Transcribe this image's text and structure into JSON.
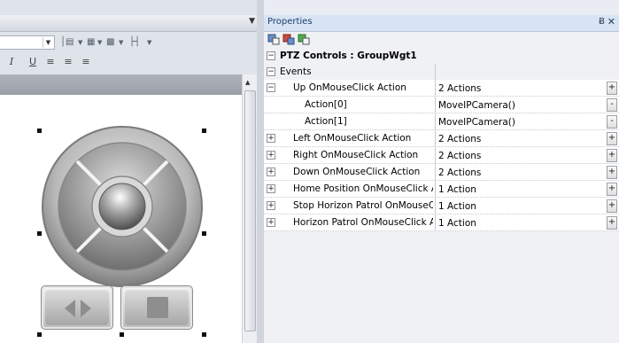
{
  "toolbar": {
    "font_combo_value": "",
    "icons": [
      "align-left-icon",
      "grid-icon",
      "distribute-icon"
    ],
    "format_buttons": [
      "I",
      "U",
      "align-left",
      "align-center",
      "align-right"
    ]
  },
  "properties": {
    "title": "Properties",
    "pin_label": "Ƀ",
    "close_label": "✕",
    "object": "PTZ Controls : GroupWgt1",
    "category": "Events",
    "rows": [
      {
        "name": "Up OnMouseClick Action",
        "value": "2 Actions",
        "expander": "−",
        "button": "+",
        "indent": 1
      },
      {
        "name": "Action[0]",
        "value": "MoveIPCamera()",
        "expander": "",
        "button": "-",
        "indent": 2
      },
      {
        "name": "Action[1]",
        "value": "MoveIPCamera()",
        "expander": "",
        "button": "-",
        "indent": 2
      },
      {
        "name": "Left OnMouseClick Action",
        "value": "2 Actions",
        "expander": "+",
        "button": "+",
        "indent": 1
      },
      {
        "name": "Right OnMouseClick Action",
        "value": "2 Actions",
        "expander": "+",
        "button": "+",
        "indent": 1
      },
      {
        "name": "Down OnMouseClick Action",
        "value": "2 Actions",
        "expander": "+",
        "button": "+",
        "indent": 1
      },
      {
        "name": "Home Position OnMouseClick Act",
        "value": "1 Action",
        "expander": "+",
        "button": "+",
        "indent": 1
      },
      {
        "name": "Stop Horizon Patrol OnMouseClic",
        "value": "1 Action",
        "expander": "+",
        "button": "+",
        "indent": 1
      },
      {
        "name": "Horizon Patrol OnMouseClick Acti",
        "value": "1 Action",
        "expander": "+",
        "button": "+",
        "indent": 1
      }
    ]
  },
  "colors": {
    "accent": "#d8e4f3",
    "title_text": "#1c3f70"
  }
}
